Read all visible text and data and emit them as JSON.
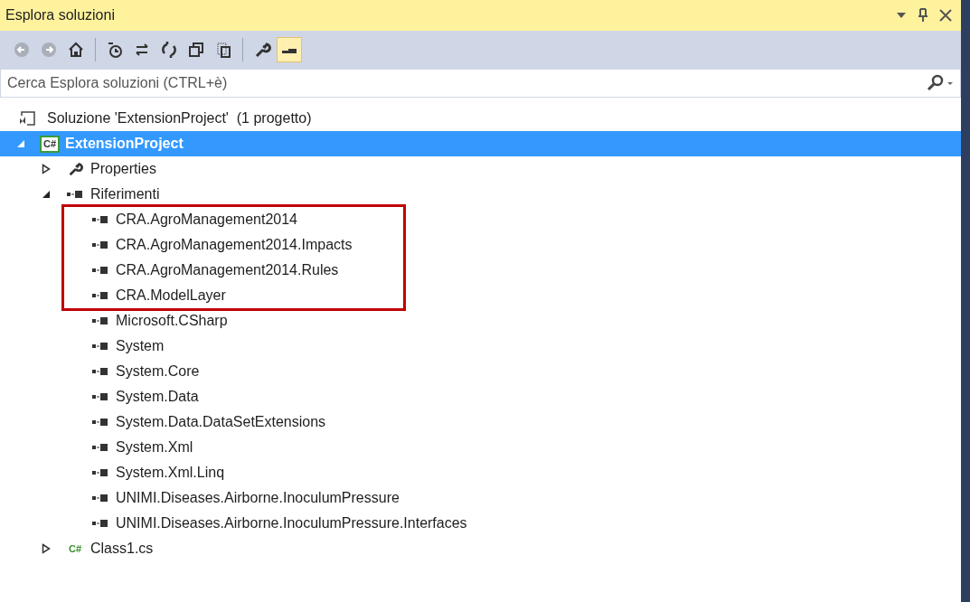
{
  "window": {
    "title": "Esplora soluzioni"
  },
  "toolbar": [
    {
      "kind": "back",
      "disabled": true
    },
    {
      "kind": "forward",
      "disabled": true
    },
    {
      "kind": "home",
      "disabled": false
    },
    {
      "kind": "separator"
    },
    {
      "kind": "pending",
      "disabled": false
    },
    {
      "kind": "sync",
      "disabled": false
    },
    {
      "kind": "refresh",
      "disabled": false
    },
    {
      "kind": "collapse",
      "disabled": false
    },
    {
      "kind": "showall",
      "disabled": false
    },
    {
      "kind": "separator"
    },
    {
      "kind": "properties",
      "disabled": false
    },
    {
      "kind": "preview",
      "disabled": false,
      "selected": true
    }
  ],
  "search": {
    "placeholder": "Cerca Esplora soluzioni (CTRL+è)"
  },
  "tree": [
    {
      "label": "Soluzione 'ExtensionProject'  (1 progetto)",
      "kind": "solution",
      "selected": false,
      "children": [
        {
          "label": "ExtensionProject",
          "kind": "project",
          "icon_text": "C#",
          "expanded": true,
          "selected": true,
          "children": [
            {
              "label": "Properties",
              "kind": "properties",
              "expanded": false,
              "selected": false
            },
            {
              "label": "Riferimenti",
              "kind": "references",
              "expanded": true,
              "selected": false,
              "children": [
                {
                  "label": "CRA.AgroManagement2014",
                  "kind": "reference",
                  "selected": false,
                  "highlighted": true
                },
                {
                  "label": "CRA.AgroManagement2014.Impacts",
                  "kind": "reference",
                  "selected": false,
                  "highlighted": true
                },
                {
                  "label": "CRA.AgroManagement2014.Rules",
                  "kind": "reference",
                  "selected": false,
                  "highlighted": true
                },
                {
                  "label": "CRA.ModelLayer",
                  "kind": "reference",
                  "selected": false,
                  "highlighted": true
                },
                {
                  "label": "Microsoft.CSharp",
                  "kind": "reference",
                  "selected": false,
                  "highlighted": false
                },
                {
                  "label": "System",
                  "kind": "reference",
                  "selected": false,
                  "highlighted": false
                },
                {
                  "label": "System.Core",
                  "kind": "reference",
                  "selected": false,
                  "highlighted": false
                },
                {
                  "label": "System.Data",
                  "kind": "reference",
                  "selected": false,
                  "highlighted": false
                },
                {
                  "label": "System.Data.DataSetExtensions",
                  "kind": "reference",
                  "selected": false,
                  "highlighted": false
                },
                {
                  "label": "System.Xml",
                  "kind": "reference",
                  "selected": false,
                  "highlighted": false
                },
                {
                  "label": "System.Xml.Linq",
                  "kind": "reference",
                  "selected": false,
                  "highlighted": false
                },
                {
                  "label": "UNIMI.Diseases.Airborne.InoculumPressure",
                  "kind": "reference",
                  "selected": false,
                  "highlighted": false
                },
                {
                  "label": "UNIMI.Diseases.Airborne.InoculumPressure.Interfaces",
                  "kind": "reference",
                  "selected": false,
                  "highlighted": false
                }
              ]
            },
            {
              "label": "Class1.cs",
              "kind": "file",
              "icon_text": "C#",
              "expanded": false,
              "selected": false
            }
          ]
        }
      ]
    }
  ]
}
